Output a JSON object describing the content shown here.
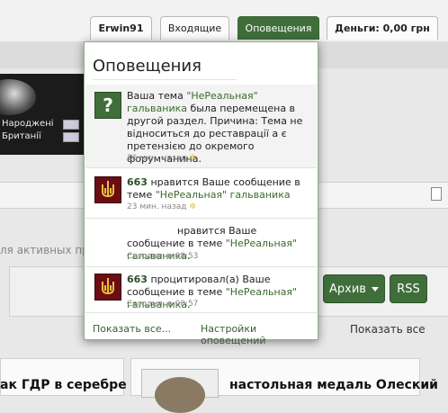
{
  "nav": {
    "user": "Erwin91",
    "inbox": "Входящие",
    "alerts": "Оповещения",
    "money": "Деньги: 0,00 грн"
  },
  "banner": {
    "line1": "Народжені",
    "line2": "Британії"
  },
  "background": {
    "activity_text": "ля активных про",
    "archive_button": "Архив",
    "rss_button": "RSS",
    "show_all_right": "Показать все",
    "card1_text": "ак ГДР в серебре",
    "card2_text": "настольная медаль Олеский"
  },
  "dropdown": {
    "title": "Оповещения",
    "footer_show_all": "Показать все...",
    "footer_settings": "Настройки оповещений"
  },
  "alerts": [
    {
      "avatar": "question-avatar",
      "prefix": "Ваша тема ",
      "link": "\"НеРеальная\" гальваника",
      "rest": " была перемещена в другой раздел. Причина: Тема не відноситься до реставрації а є претензією до окремого форумчанина.",
      "time": "16 мин. назад"
    },
    {
      "avatar": "trident-avatar",
      "user": "663",
      "action": " нравится Ваше сообщение в теме ",
      "link": "\"НеРеальная\" гальваника",
      "time": "23 мин. назад"
    },
    {
      "avatar": "blank-avatar",
      "action": "нравится Ваше сообщение в теме ",
      "link": "\"НеРеальная\" гальваника",
      "tail": ".",
      "time": "Сегодня, в 08:53"
    },
    {
      "avatar": "trident-avatar",
      "user": "663",
      "action": " процитировал(а) Ваше сообщение в теме ",
      "link": "\"НеРеальная\" гальваника",
      "tail": ".",
      "time": "Сегодня, в 00:57"
    }
  ]
}
